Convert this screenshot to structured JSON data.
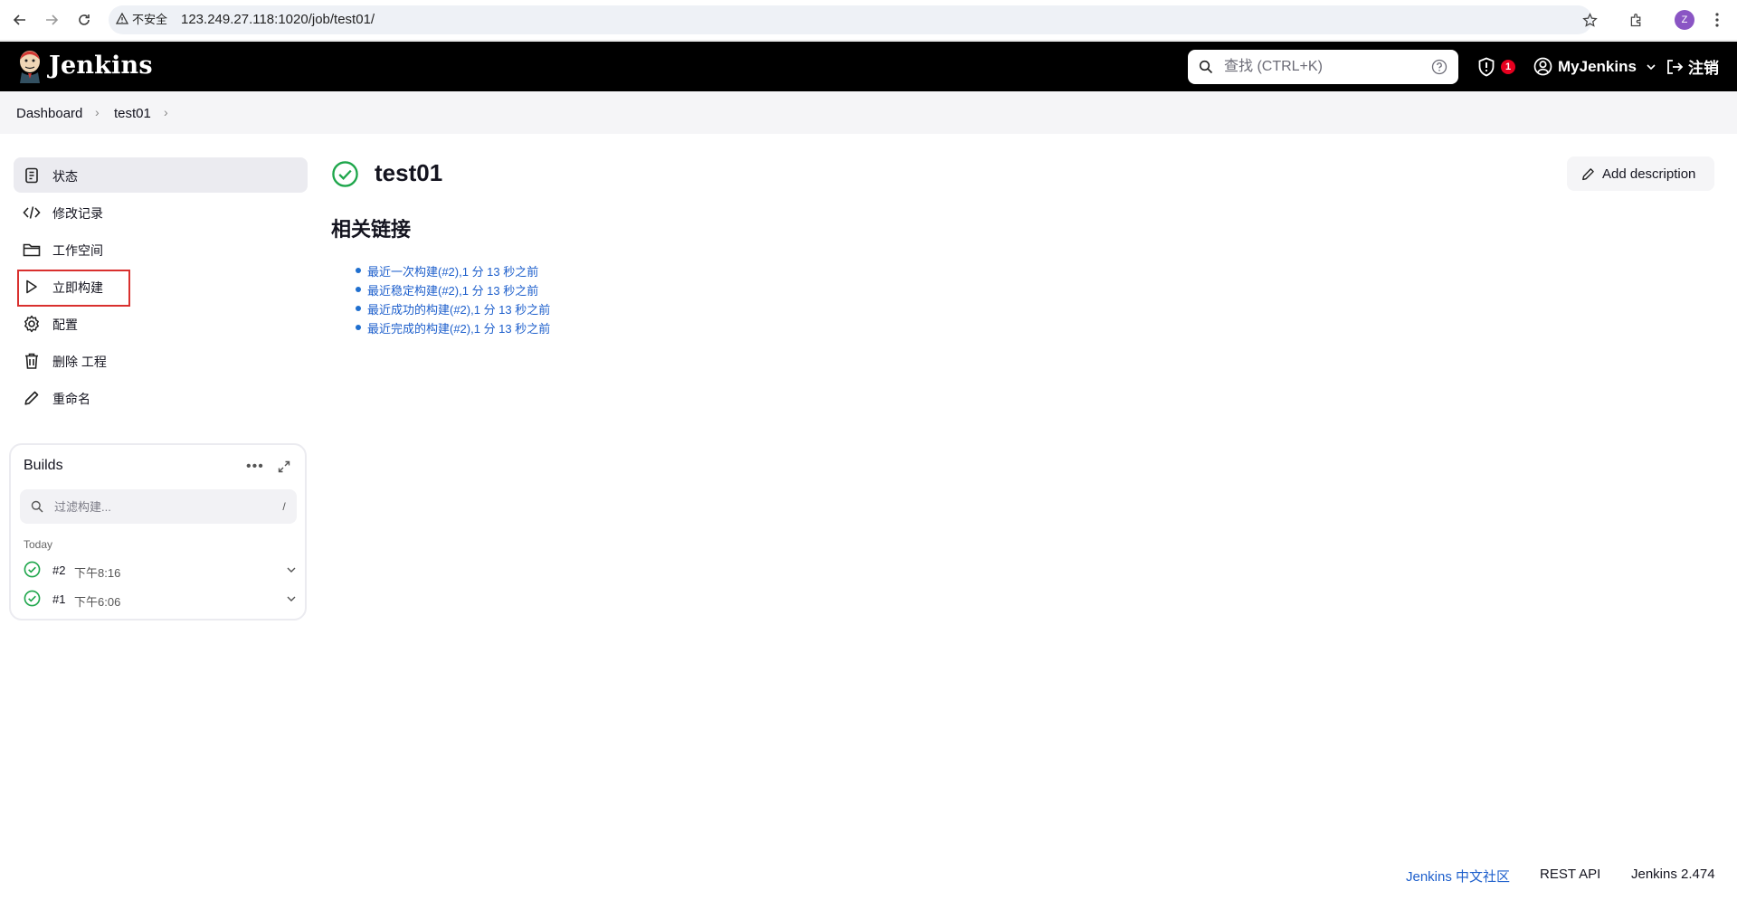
{
  "browser": {
    "security_label": "不安全",
    "url": "123.249.27.118:1020/job/test01/",
    "profile_initial": "Z"
  },
  "header": {
    "brand": "Jenkins",
    "search_placeholder": "查找 (CTRL+K)",
    "security_count": "1",
    "user": "MyJenkins",
    "logout": "注销"
  },
  "breadcrumb": [
    "Dashboard",
    "test01"
  ],
  "sidebar": {
    "items": [
      {
        "label": "状态",
        "icon": "status-icon",
        "active": true
      },
      {
        "label": "修改记录",
        "icon": "code-icon"
      },
      {
        "label": "工作空间",
        "icon": "folder-icon"
      },
      {
        "label": "立即构建",
        "icon": "play-icon"
      },
      {
        "label": "配置",
        "icon": "gear-icon"
      },
      {
        "label": "删除 工程",
        "icon": "trash-icon"
      },
      {
        "label": "重命名",
        "icon": "pencil-icon"
      }
    ]
  },
  "builds": {
    "title": "Builds",
    "filter_placeholder": "过滤构建...",
    "filter_shortcut": "/",
    "group_label": "Today",
    "items": [
      {
        "number": "#2",
        "time": "下午8:16",
        "status": "success"
      },
      {
        "number": "#1",
        "time": "下午6:06",
        "status": "success"
      }
    ]
  },
  "main": {
    "title": "test01",
    "add_description": "Add description",
    "section_title": "相关链接",
    "links": [
      "最近一次构建(#2),1 分 13 秒之前",
      "最近稳定构建(#2),1 分 13 秒之前",
      "最近成功的构建(#2),1 分 13 秒之前",
      "最近完成的构建(#2),1 分 13 秒之前"
    ]
  },
  "footer": {
    "community": "Jenkins 中文社区",
    "rest_api": "REST API",
    "version": "Jenkins 2.474"
  },
  "colors": {
    "success": "#1ea64b",
    "link": "#1d5fcc",
    "highlight": "#d9302e",
    "badge": "#e6001f"
  }
}
